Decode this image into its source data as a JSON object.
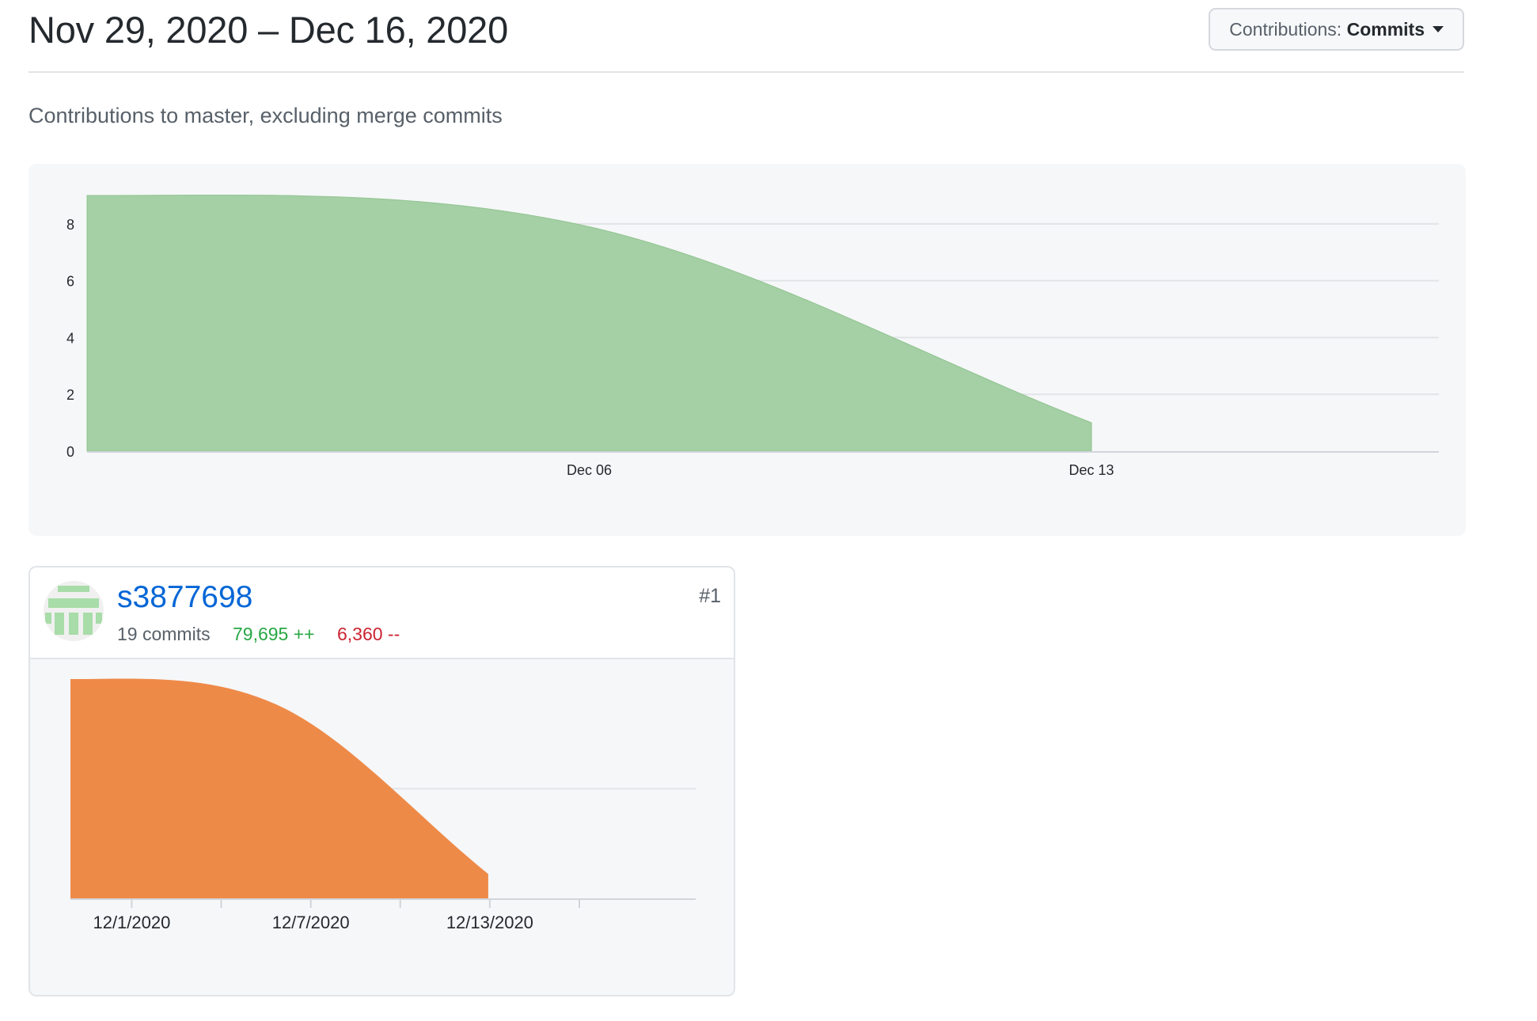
{
  "header": {
    "date_range": "Nov 29, 2020 – Dec 16, 2020",
    "contributions_label": "Contributions:",
    "contributions_value": "Commits"
  },
  "subtitle": "Contributions to master, excluding merge commits",
  "colors": {
    "main_area": "#a5cfa5",
    "main_area_stroke": "#8fc48f",
    "user_area": "#ee8a48",
    "grid": "#e1e4e8",
    "axis": "#d1d5da",
    "link": "#0366d6",
    "additions": "#28a745",
    "deletions": "#cb2431"
  },
  "contributor": {
    "username": "s3877698",
    "commits": "19 commits",
    "additions": "79,695 ++",
    "deletions": "6,360 --",
    "rank": "#1",
    "avatar_icon": "identicon-avatar"
  },
  "chart_data": [
    {
      "type": "area",
      "title": "",
      "xlabel": "",
      "ylabel": "",
      "x": [
        "2020-11-29",
        "2020-12-06",
        "2020-12-13"
      ],
      "series": [
        {
          "values": [
            9,
            7.9,
            1
          ]
        }
      ],
      "x_ticks": [
        "Dec 06",
        "Dec 13"
      ],
      "y_ticks": [
        "0",
        "2",
        "4",
        "6",
        "8"
      ],
      "xlim": [
        "2020-11-29",
        "2020-12-16"
      ],
      "ylim": [
        0,
        9
      ],
      "grid": true,
      "legend": "none"
    },
    {
      "type": "area",
      "title": "",
      "xlabel": "",
      "ylabel": "",
      "x": [
        "2020-11-29",
        "2020-12-06",
        "2020-12-13"
      ],
      "series": [
        {
          "values": [
            9,
            7.9,
            1
          ]
        }
      ],
      "x_ticks": [
        "12/1/2020",
        "12/7/2020",
        "12/13/2020"
      ],
      "ylim": [
        0,
        9
      ],
      "grid": true,
      "legend": "none"
    }
  ]
}
